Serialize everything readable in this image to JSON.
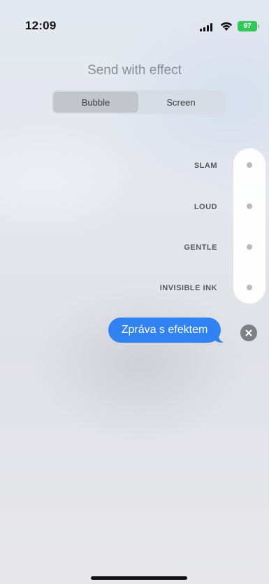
{
  "status_bar": {
    "time": "12:09",
    "battery": "97",
    "icons": [
      "signal-icon",
      "wifi-icon",
      "battery-icon"
    ]
  },
  "title": "Send with effect",
  "tabs": [
    {
      "label": "Bubble",
      "active": true
    },
    {
      "label": "Screen",
      "active": false
    }
  ],
  "effects": [
    {
      "label": "SLAM"
    },
    {
      "label": "LOUD"
    },
    {
      "label": "GENTLE"
    },
    {
      "label": "INVISIBLE INK"
    }
  ],
  "message": {
    "text": "Zpráva s efektem",
    "color": "#2f82f0"
  },
  "colors": {
    "accent": "#2f82f0",
    "battery": "#34c759"
  }
}
